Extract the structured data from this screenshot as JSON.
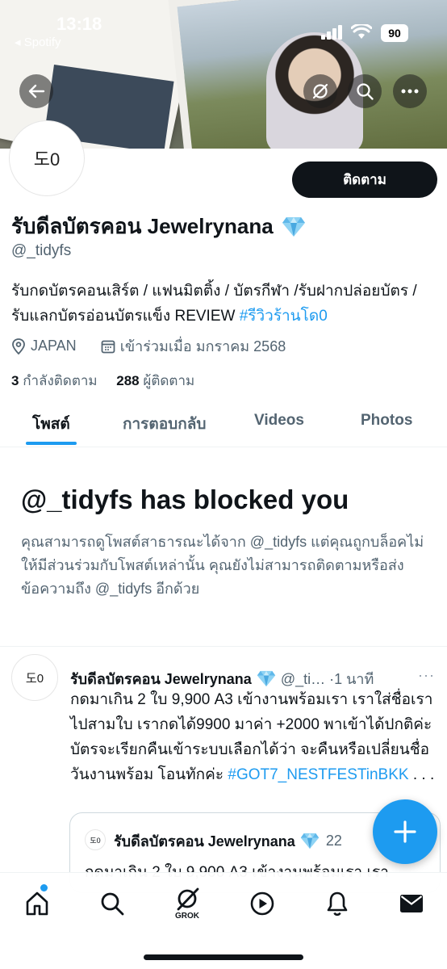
{
  "status_bar": {
    "time": "13:18",
    "back_app": "◂ Spotify",
    "battery": "90"
  },
  "profile": {
    "avatar_text": "도0",
    "follow_label": "ติดตาม",
    "display_name": "รับดีลบัตรคอน Jewelrynana",
    "handle": "@_tidyfs",
    "bio_text": "รับกดบัตรคอนเสิร์ต / แฟนมิตติ้ง / บัตรกีฬา /รับฝากปล่อยบัตร / รับแลกบัตรอ่อนบัตรแข็ง REVIEW",
    "bio_hashtag": "#รีวิวร้านโด0",
    "location": "JAPAN",
    "joined": "เข้าร่วมเมื่อ มกราคม 2568",
    "following_count": "3",
    "following_label": "กำลังติดตาม",
    "followers_count": "288",
    "followers_label": "ผู้ติดตาม"
  },
  "tabs": [
    {
      "label": "โพสต์"
    },
    {
      "label": "การตอบกลับ"
    },
    {
      "label": "Videos"
    },
    {
      "label": "Photos"
    }
  ],
  "blocked": {
    "title": "@_tidyfs has blocked you",
    "description": "คุณสามารถดูโพสต์สาธารณะได้จาก @_tidyfs แต่คุณถูกบล็อคไม่ให้มีส่วนร่วมกับโพสต์เหล่านั้น คุณยังไม่สามารถติดตามหรือส่งข้อความถึง @_tidyfs อีกด้วย"
  },
  "tweet": {
    "avatar_text": "도0",
    "author": "รับดีลบัตรคอน Jewelrynana",
    "handle_time": "@_ti… ·1 นาที",
    "more": "···",
    "body": "กดมาเกิน 2 ใบ  9,900 A3 เข้างานพร้อมเรา เราใส่ชื่อเราไปสามใบ เรากดได้9900 มาค่า +2000 พาเข้าได้ปกติค่ะ บัตรจะเรียกคืนเข้าระบบเลือกได้ว่า จะคืนหรือเปลี่ยนชื่อ วันงานพร้อม โอนทักค่ะ",
    "hashtag": "#GOT7_NESTFESTinBKK",
    "ellipsis": " . . .",
    "quote": {
      "avatar_text": "도0",
      "author": "รับดีลบัตรคอน Jewelrynana",
      "time": "22",
      "body": "กดมาเกิน 2 ใบ  9,900 A3 เข้างานพร้อมเรา เรา"
    }
  },
  "bottom_nav": {
    "grok_label": "GROK"
  },
  "colors": {
    "accent": "#1d9bf0",
    "text": "#0f1419",
    "secondary": "#536471"
  }
}
